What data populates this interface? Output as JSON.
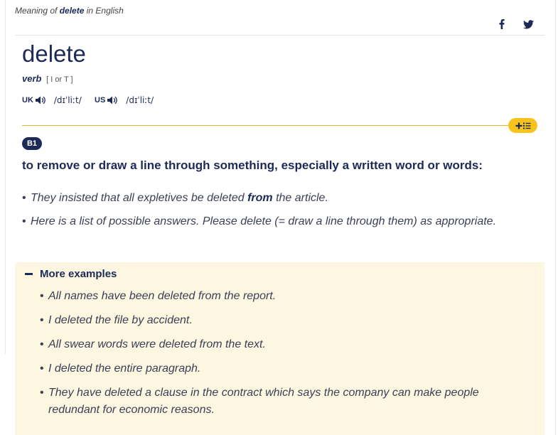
{
  "header": {
    "prefix": "Meaning of",
    "word": "delete",
    "suffix": "in English"
  },
  "social": [
    {
      "name": "facebook-icon"
    },
    {
      "name": "twitter-icon"
    }
  ],
  "entry": {
    "headword": "delete",
    "pos": "verb",
    "grammar": "[ I or T ]",
    "pron_uk": {
      "region": "UK",
      "ipa": "/dɪˈliːt/"
    },
    "pron_us": {
      "region": "US",
      "ipa": "/dɪˈliːt/"
    }
  },
  "sense": {
    "level": "B1",
    "definition": "to remove or draw a line through something, especially a written word or words:",
    "examples": [
      {
        "before": "They insisted that all expletives be deleted ",
        "bold": "from",
        "after": " the article."
      },
      {
        "text": "Here is a list of possible answers. Please delete (= draw a line through them) as appropriate."
      }
    ]
  },
  "more": {
    "label": "More examples",
    "examples": [
      "All names have been deleted from the report.",
      "I deleted the file by accident.",
      "All swear words were deleted from the text.",
      "I deleted the entire paragraph.",
      "They have deleted a clause in the contract which says the company can make people redundant for economic reasons."
    ]
  },
  "colors": {
    "navy": "#1d2a57",
    "accent_yellow": "#f9c31e",
    "panel_bg": "#fdf6e1"
  }
}
